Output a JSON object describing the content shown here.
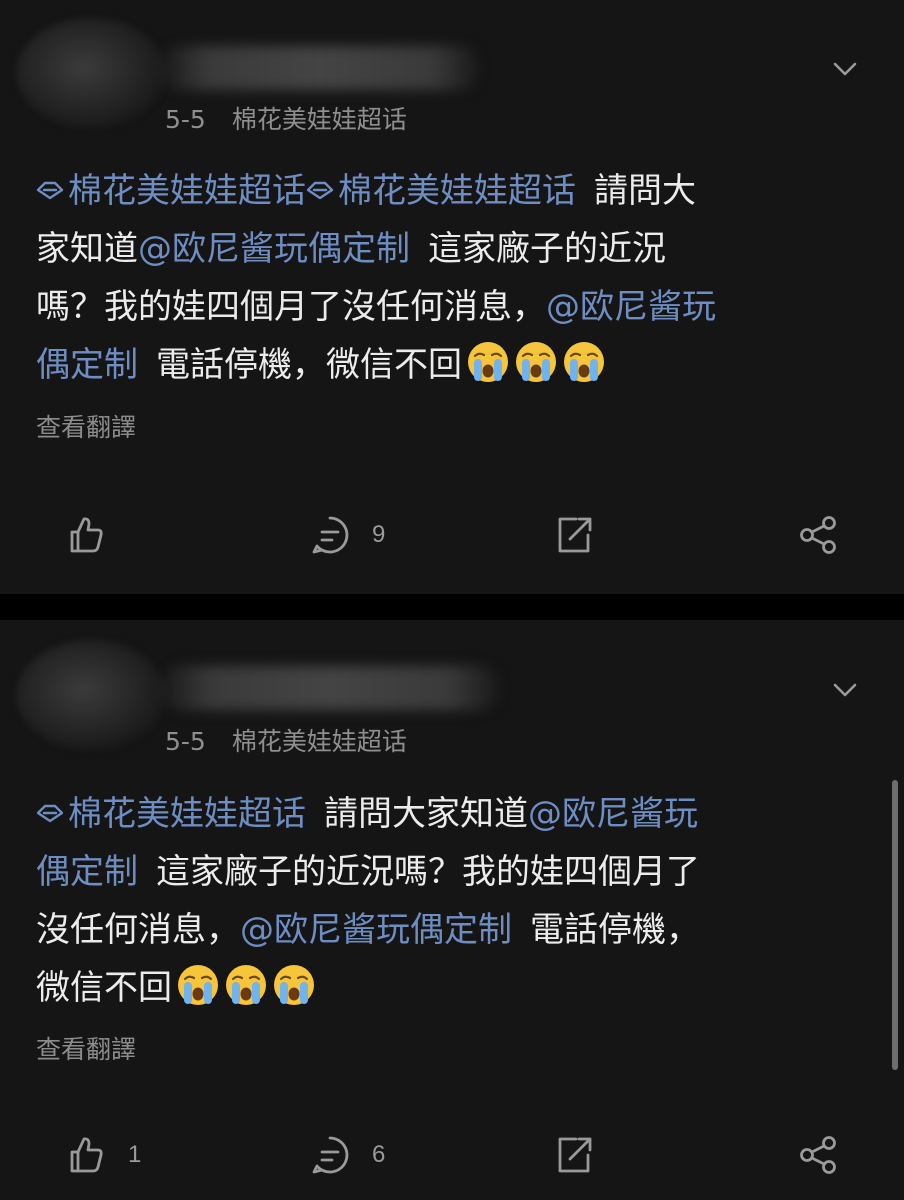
{
  "posts": [
    {
      "date": "5-5",
      "source": "棉花美娃娃超话",
      "content": {
        "tag1": "棉花美娃娃超话",
        "tag2": "棉花美娃娃超话",
        "text1": "請問大",
        "text2": "家知道",
        "mention1": "@欧尼酱玩偶定制",
        "text3": "這家廠子的近況",
        "text4": "嗎？我的娃四個月了沒任何消息，",
        "mention2": "@欧尼酱玩",
        "mention3": "偶定制",
        "text5": "電話停機，微信不回",
        "emoji": "crying-face"
      },
      "translate_label": "查看翻譯",
      "likes": "",
      "comments": "9"
    },
    {
      "date": "5-5",
      "source": "棉花美娃娃超话",
      "content": {
        "tag1": "棉花美娃娃超话",
        "text1": "請問大家知道",
        "mention1": "@欧尼酱玩",
        "mention2": "偶定制",
        "text2": "這家廠子的近況嗎？我的娃四個月了",
        "text3": "沒任何消息，",
        "mention3": "@欧尼酱玩偶定制",
        "text4": "電話停機，",
        "text5": "微信不回",
        "emoji": "crying-face"
      },
      "translate_label": "查看翻譯",
      "likes": "1",
      "comments": "6"
    }
  ],
  "colors": {
    "background": "#000000",
    "card": "#151515",
    "link": "#6e8dc2",
    "meta": "#8f8f8f"
  }
}
